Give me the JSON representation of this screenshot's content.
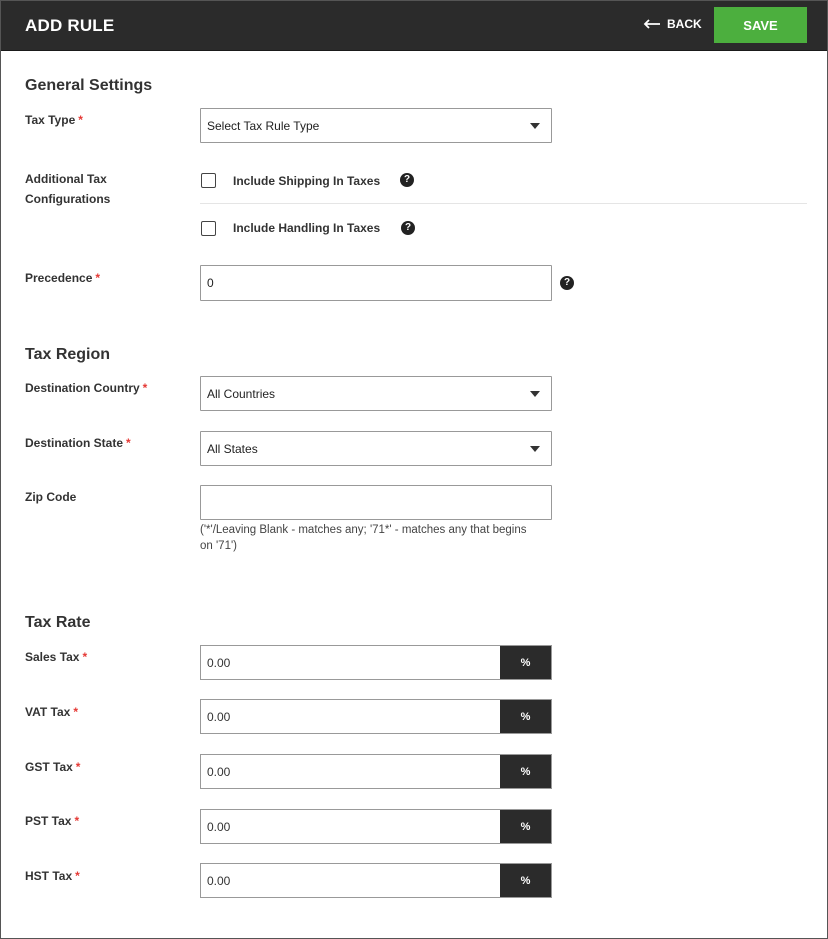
{
  "header": {
    "title": "ADD RULE",
    "back_label": "BACK",
    "save_label": "SAVE"
  },
  "general": {
    "section_title": "General Settings",
    "tax_type": {
      "label": "Tax Type",
      "value": "Select Tax Rule Type"
    },
    "additional": {
      "label_line1": "Additional Tax",
      "label_line2": "Configurations",
      "shipping_label": "Include Shipping In Taxes",
      "handling_label": "Include Handling In Taxes"
    },
    "precedence": {
      "label": "Precedence",
      "value": "0"
    }
  },
  "region": {
    "section_title": "Tax Region",
    "country": {
      "label": "Destination Country",
      "value": "All Countries"
    },
    "state": {
      "label": "Destination State",
      "value": "All States"
    },
    "zip": {
      "label": "Zip Code",
      "value": "",
      "hint_line1": "('*'/Leaving Blank - matches any; '71*' - matches any that begins",
      "hint_line2": "on '71')"
    }
  },
  "rate": {
    "section_title": "Tax Rate",
    "unit": "%",
    "items": [
      {
        "label": "Sales Tax",
        "value": "0.00"
      },
      {
        "label": "VAT Tax",
        "value": "0.00"
      },
      {
        "label": "GST Tax",
        "value": "0.00"
      },
      {
        "label": "PST Tax",
        "value": "0.00"
      },
      {
        "label": "HST Tax",
        "value": "0.00"
      }
    ]
  },
  "colors": {
    "header_bg": "#2b2b2b",
    "save_bg": "#4caf3e",
    "required": "#e53935"
  }
}
